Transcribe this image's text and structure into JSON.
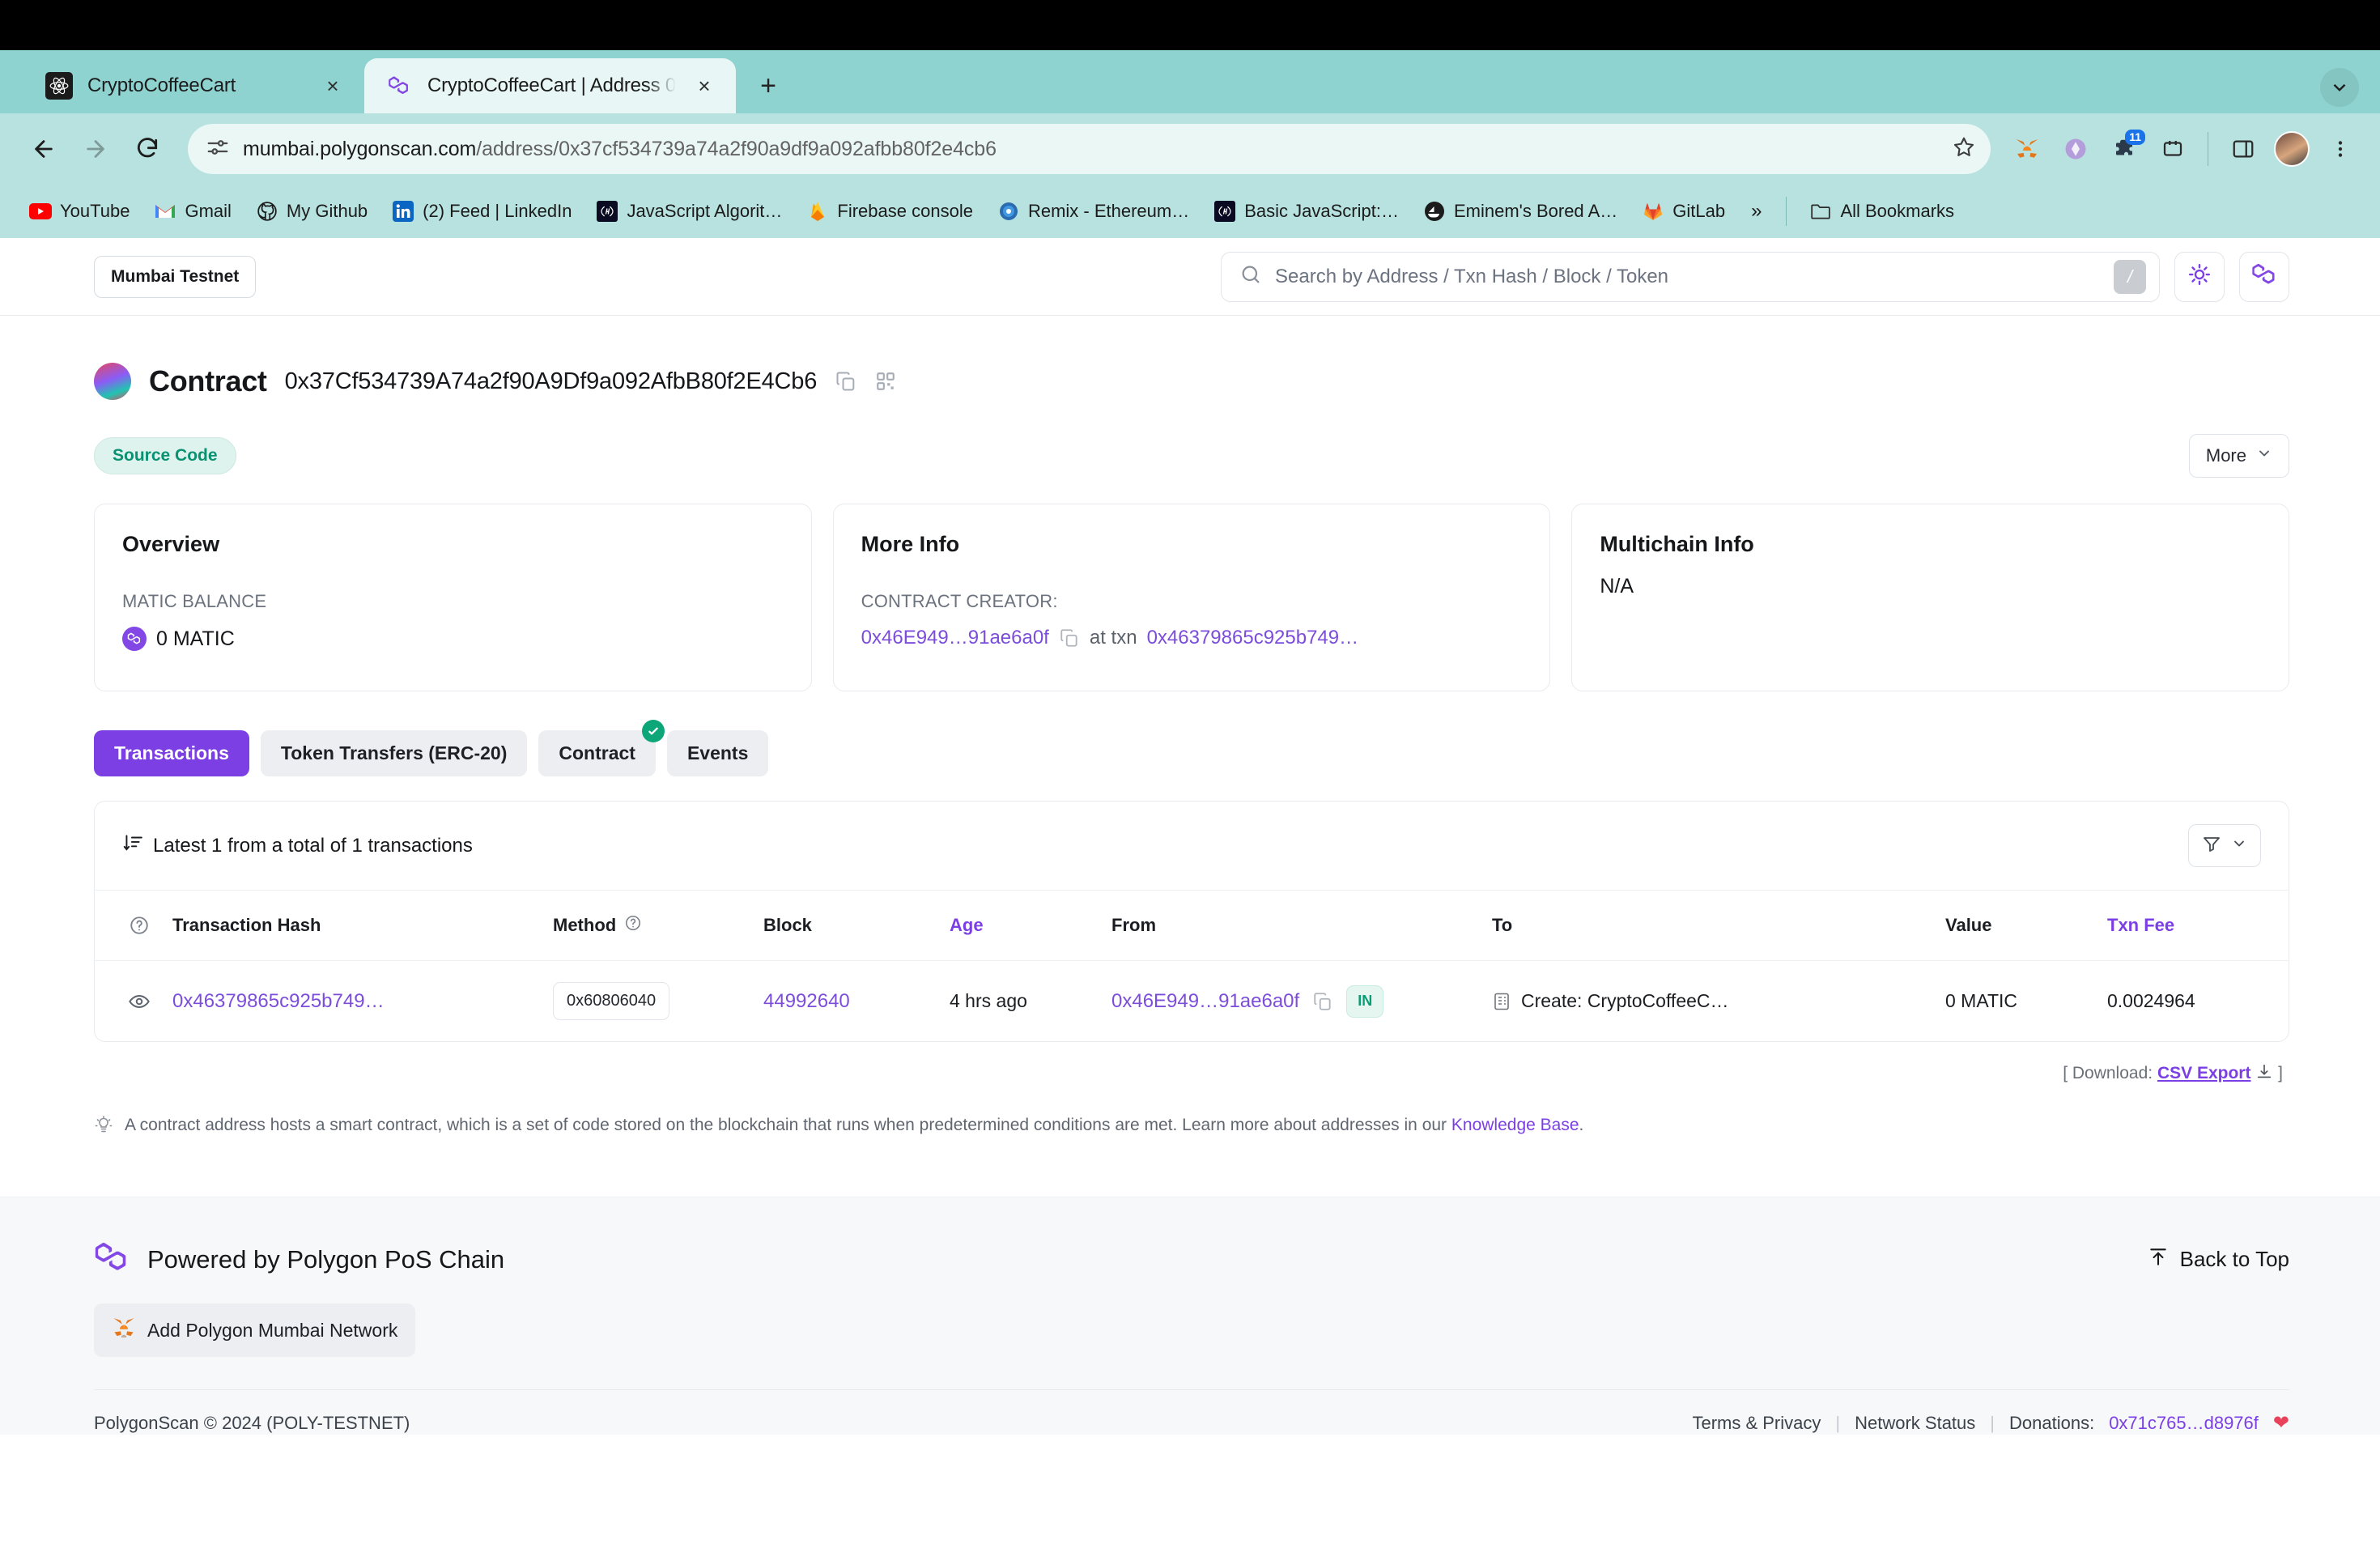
{
  "browser": {
    "tabs": [
      {
        "title": "CryptoCoffeeCart",
        "favicon": "react-icon",
        "active": false,
        "close_label": "×"
      },
      {
        "title": "CryptoCoffeeCart | Address 0",
        "favicon": "polygon-icon",
        "active": true,
        "close_label": "×"
      }
    ],
    "new_tab_label": "+",
    "nav": {
      "back": "←",
      "forward": "→",
      "reload": "↻"
    },
    "omnibox": {
      "domain": "mumbai.polygonscan.com",
      "path": "/address/0x37cf534739a74a2f90a9df9a092afbb80f2e4cb6",
      "site_info_icon": "page-settings-icon",
      "bookmark_icon": "star-icon"
    },
    "extensions": [
      {
        "name": "metamask-extension-icon",
        "badge": ""
      },
      {
        "name": "wallet-extension-icon",
        "badge": ""
      },
      {
        "name": "puzzle-extension-icon",
        "badge": "11"
      },
      {
        "name": "extensions-icon",
        "badge": ""
      },
      {
        "name": "sidepanel-icon",
        "badge": ""
      },
      {
        "name": "profile-avatar",
        "badge": ""
      },
      {
        "name": "chrome-menu-icon",
        "badge": ""
      }
    ],
    "bookmarks": [
      {
        "label": "YouTube",
        "icon": "youtube-icon"
      },
      {
        "label": "Gmail",
        "icon": "gmail-icon"
      },
      {
        "label": "My Github",
        "icon": "github-icon"
      },
      {
        "label": "(2) Feed | LinkedIn",
        "icon": "linkedin-icon"
      },
      {
        "label": "JavaScript Algorit…",
        "icon": "freecodecamp-icon"
      },
      {
        "label": "Firebase console",
        "icon": "firebase-icon"
      },
      {
        "label": "Remix - Ethereum…",
        "icon": "remix-icon"
      },
      {
        "label": "Basic JavaScript:…",
        "icon": "freecodecamp-icon"
      },
      {
        "label": "Eminem's Bored A…",
        "icon": "opensea-icon"
      },
      {
        "label": "GitLab",
        "icon": "gitlab-icon"
      }
    ],
    "bookmarks_overflow": "»",
    "all_bookmarks_label": "All Bookmarks"
  },
  "site": {
    "network_pill": "Mumbai Testnet",
    "search": {
      "placeholder": "Search by Address / Txn Hash / Block / Token",
      "shortcut_key": "/"
    },
    "theme_toggle_icon": "sun-icon",
    "polygon_icon": "polygon-logo-icon"
  },
  "contract": {
    "label": "Contract",
    "address": "0x37Cf534739A74a2f90A9Df9a092AfbB80f2E4Cb6",
    "copy_icon": "copy-icon",
    "qr_icon": "qr-code-icon",
    "source_code_chip": "Source Code",
    "more_button": "More"
  },
  "cards": {
    "overview": {
      "title": "Overview",
      "balance_label": "MATIC BALANCE",
      "balance_value": "0 MATIC"
    },
    "more_info": {
      "title": "More Info",
      "creator_label": "CONTRACT CREATOR:",
      "creator_address": "0x46E949…91ae6a0f",
      "at_txn_label": "at txn",
      "creation_txn": "0x46379865c925b749…"
    },
    "multichain": {
      "title": "Multichain Info",
      "value": "N/A"
    }
  },
  "tabs": [
    {
      "label": "Transactions",
      "selected": true,
      "badge": false
    },
    {
      "label": "Token Transfers (ERC-20)",
      "selected": false,
      "badge": false
    },
    {
      "label": "Contract",
      "selected": false,
      "badge": true
    },
    {
      "label": "Events",
      "selected": false,
      "badge": false
    }
  ],
  "table": {
    "caption": "Latest 1 from a total of 1 transactions",
    "sort_icon": "sort-descending-icon",
    "filter_icon": "funnel-icon",
    "columns": [
      "",
      "Transaction Hash",
      "Method",
      "Block",
      "Age",
      "From",
      "",
      "To",
      "Value",
      "Txn Fee"
    ],
    "rows": [
      {
        "eye_icon": "eye-icon",
        "hash": "0x46379865c925b749…",
        "method": "0x60806040",
        "block": "44992640",
        "age": "4 hrs ago",
        "from": "0x46E949…91ae6a0f",
        "from_copy_icon": "copy-icon",
        "direction": "IN",
        "to_icon": "contract-icon",
        "to": "Create: CryptoCoffeeC…",
        "value": "0 MATIC",
        "txn_fee": "0.0024964"
      }
    ],
    "download_prefix": "[ Download:",
    "download_link": "CSV Export",
    "download_icon": "download-icon",
    "download_suffix": "]"
  },
  "knowledge_note": {
    "icon": "lightbulb-icon",
    "text": "A contract address hosts a smart contract, which is a set of code stored on the blockchain that runs when predetermined conditions are met. Learn more about addresses in our",
    "link": "Knowledge Base",
    "period": "."
  },
  "footer": {
    "powered_by": "Powered by Polygon PoS Chain",
    "powered_icon": "polygon-logo-icon",
    "back_to_top": "Back to Top",
    "back_to_top_icon": "arrow-up-icon",
    "add_network_button": "Add Polygon Mumbai Network",
    "metamask_icon": "metamask-fox-icon",
    "copyright": "PolygonScan © 2024 (POLY-TESTNET)",
    "links": [
      {
        "label": "Terms & Privacy",
        "purple": false
      },
      {
        "label": "Network Status",
        "purple": false
      }
    ],
    "donations_label": "Donations:",
    "donations_address": "0x71c765…d8976f",
    "heart_icon": "heart-icon"
  }
}
